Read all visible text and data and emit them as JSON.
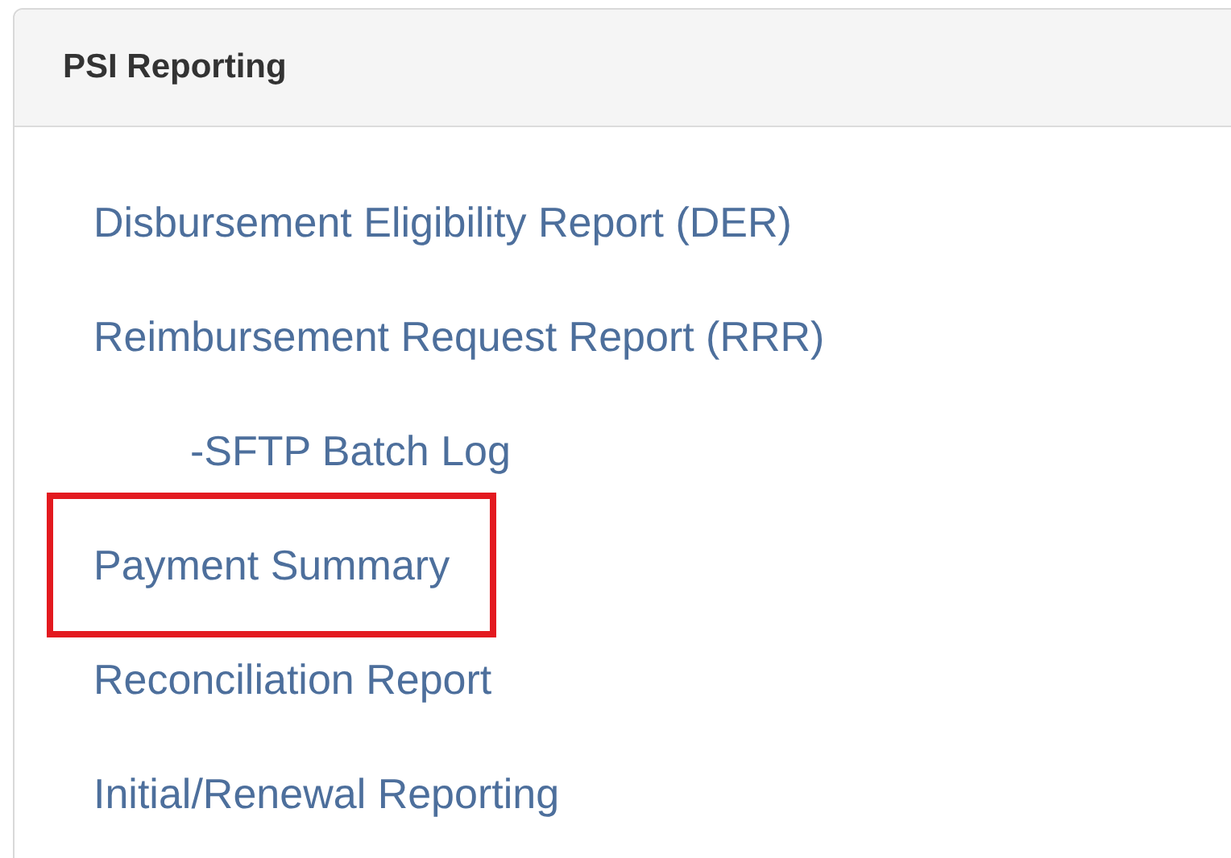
{
  "panel": {
    "title": "PSI Reporting"
  },
  "links": [
    {
      "label": "Disbursement Eligibility Report (DER)",
      "highlighted": false
    },
    {
      "label": "Reimbursement Request Report (RRR)",
      "highlighted": false,
      "children": [
        {
          "label": "-SFTP Batch Log",
          "highlighted": false
        }
      ]
    },
    {
      "label": "Payment Summary",
      "highlighted": true
    },
    {
      "label": "Reconciliation Report",
      "highlighted": false
    },
    {
      "label": "Initial/Renewal Reporting",
      "highlighted": false
    }
  ]
}
